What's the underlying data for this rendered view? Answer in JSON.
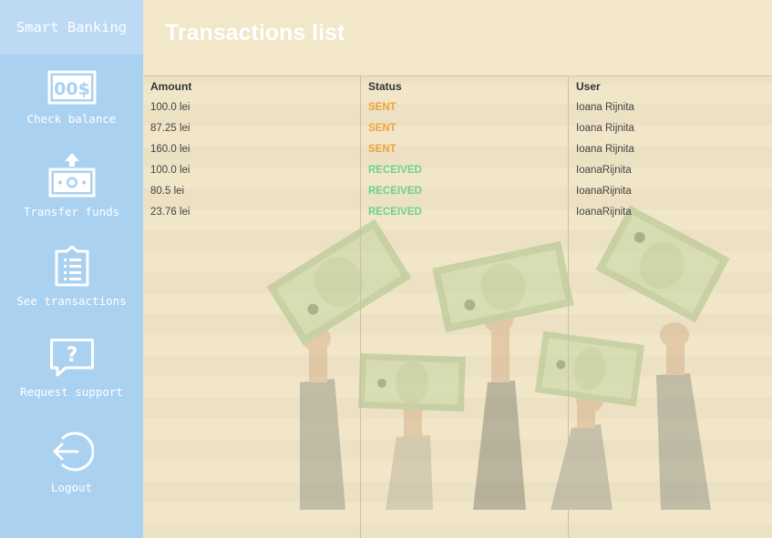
{
  "sidebar": {
    "brand": "Smart Banking",
    "items": [
      {
        "label": "Check balance",
        "icon": "banknote-dollar-icon"
      },
      {
        "label": "Transfer funds",
        "icon": "money-transfer-icon"
      },
      {
        "label": "See transactions",
        "icon": "clipboard-list-icon"
      },
      {
        "label": "Request support",
        "icon": "question-bubble-icon"
      },
      {
        "label": "Logout",
        "icon": "logout-icon"
      }
    ]
  },
  "main": {
    "title": "Transactions list",
    "table": {
      "columns": [
        "Amount",
        "Status",
        "User"
      ],
      "rows": [
        {
          "amount": "100.0 lei",
          "status": "SENT",
          "user": "Ioana Rijnita"
        },
        {
          "amount": "87.25 lei",
          "status": "SENT",
          "user": "Ioana Rijnita"
        },
        {
          "amount": "160.0 lei",
          "status": "SENT",
          "user": "Ioana Rijnita"
        },
        {
          "amount": "100.0 lei",
          "status": "RECEIVED",
          "user": "IoanaRijnita"
        },
        {
          "amount": "80.5 lei",
          "status": "RECEIVED",
          "user": "IoanaRijnita"
        },
        {
          "amount": "23.76 lei",
          "status": "RECEIVED",
          "user": "IoanaRijnita"
        }
      ]
    }
  },
  "colors": {
    "sidebar": "#aad1f0",
    "brand_bg": "#bcdaf4",
    "main_bg": "#f2e7c9",
    "sent": "#efa43c",
    "received": "#6cd28b"
  }
}
